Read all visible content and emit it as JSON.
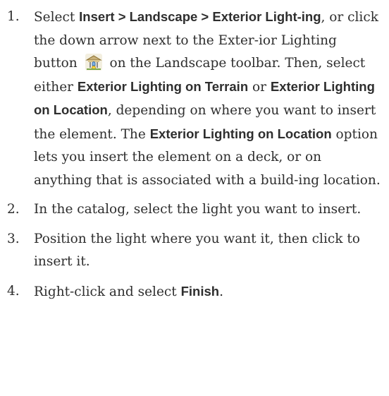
{
  "steps": [
    {
      "number": "1.",
      "parts": {
        "t1": "Select ",
        "b1": "Insert > Landscape > Exterior Light-ing",
        "t2": ", or click the down arrow next to the Exter-ior Lighting button ",
        "icon": "exterior-lighting-icon",
        "t3": " on the Landscape toolbar. Then, select either ",
        "b2": "Exterior Lighting on Terrain",
        "t4": " or ",
        "b3": "Exterior Lighting on Location",
        "t5": ", depending on where you want to insert the element. The ",
        "b4": "Exterior Lighting on Location",
        "t6": " option lets you insert the element on a deck, or on anything that is associated with a build-ing location."
      }
    },
    {
      "number": "2.",
      "text": "In the catalog, select the light you want to insert."
    },
    {
      "number": "3.",
      "text": "Position the light where you want it, then click to insert it."
    },
    {
      "number": "4.",
      "parts": {
        "t1": "Right-click and select ",
        "b1": "Finish",
        "t2": "."
      }
    }
  ]
}
